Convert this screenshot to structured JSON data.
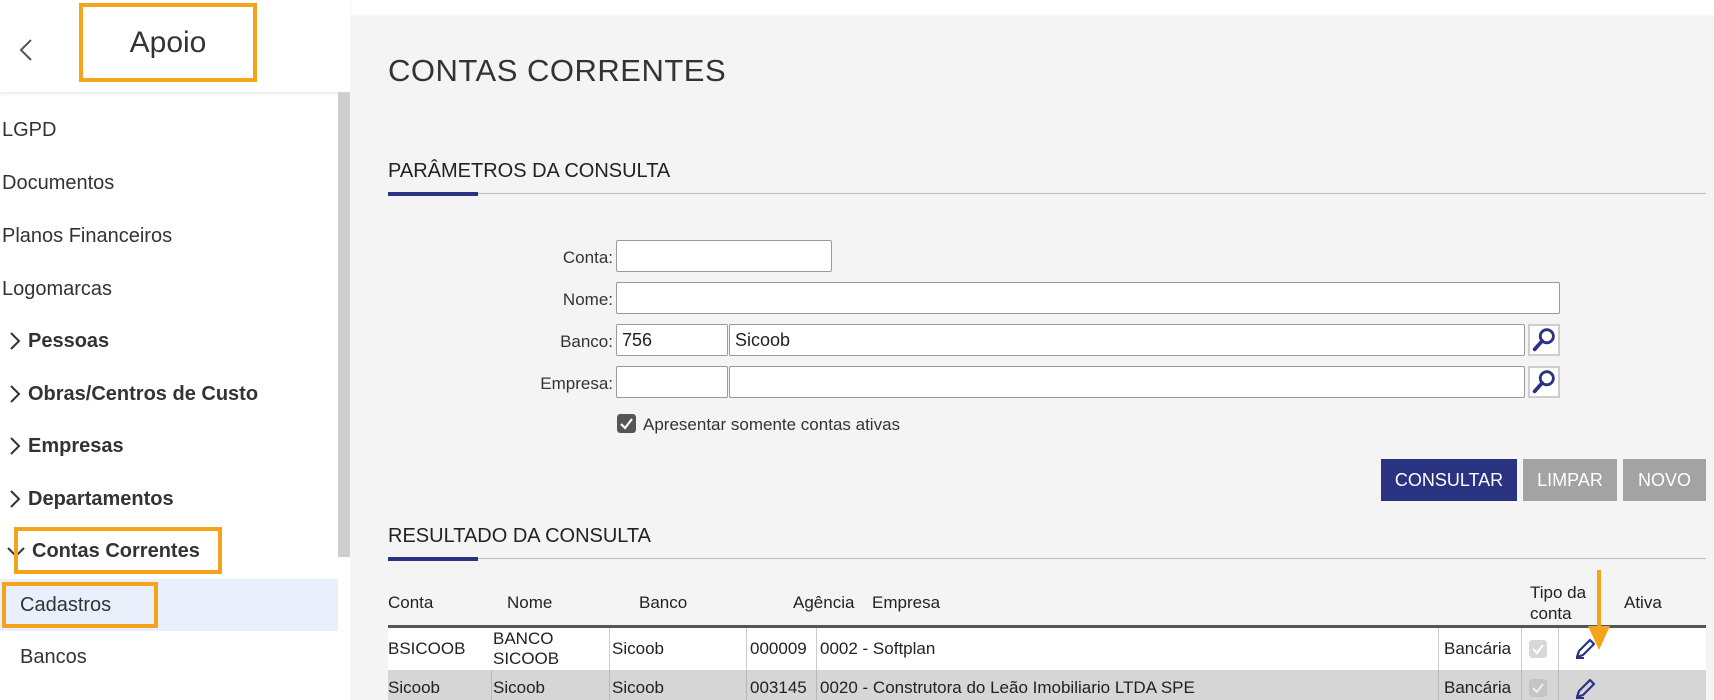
{
  "sidebar": {
    "title": "Apoio",
    "items": [
      {
        "label": "LGPD"
      },
      {
        "label": "Documentos"
      },
      {
        "label": "Planos Financeiros"
      },
      {
        "label": "Logomarcas"
      },
      {
        "label": "Pessoas"
      },
      {
        "label": "Obras/Centros de Custo"
      },
      {
        "label": "Empresas"
      },
      {
        "label": "Departamentos"
      },
      {
        "label": "Contas Correntes"
      },
      {
        "label": "Cadastros"
      },
      {
        "label": "Bancos"
      }
    ]
  },
  "page": {
    "title": "CONTAS CORRENTES",
    "params_title": "PARÂMETROS DA CONSULTA",
    "results_title": "RESULTADO DA CONSULTA"
  },
  "form": {
    "conta_label": "Conta:",
    "conta_value": "",
    "nome_label": "Nome:",
    "nome_value": "",
    "banco_label": "Banco:",
    "banco_code": "756",
    "banco_name": "Sicoob",
    "empresa_label": "Empresa:",
    "empresa_code": "",
    "empresa_name": "",
    "active_only_label": "Apresentar somente contas ativas",
    "active_only_checked": true
  },
  "buttons": {
    "consultar": "CONSULTAR",
    "limpar": "LIMPAR",
    "novo": "NOVO"
  },
  "table": {
    "headers": {
      "conta": "Conta",
      "nome": "Nome",
      "banco": "Banco",
      "agencia": "Agência",
      "empresa": "Empresa",
      "tipo": "Tipo da conta",
      "ativa": "Ativa"
    },
    "rows": [
      {
        "conta": "BSICOOB",
        "nome": "BANCO SICOOB",
        "banco": "Sicoob",
        "agencia": "000009",
        "empresa": "0002 - Softplan",
        "tipo": "Bancária",
        "ativa": true
      },
      {
        "conta": "Sicoob",
        "nome": "Sicoob",
        "banco": "Sicoob",
        "agencia": "003145",
        "empresa": "0020 - Construtora do Leão Imobiliario LTDA SPE",
        "tipo": "Bancária",
        "ativa": true
      }
    ]
  },
  "colors": {
    "primary": "#2a3381",
    "highlight": "#f5a31a",
    "disabled": "#a3a3a3"
  }
}
